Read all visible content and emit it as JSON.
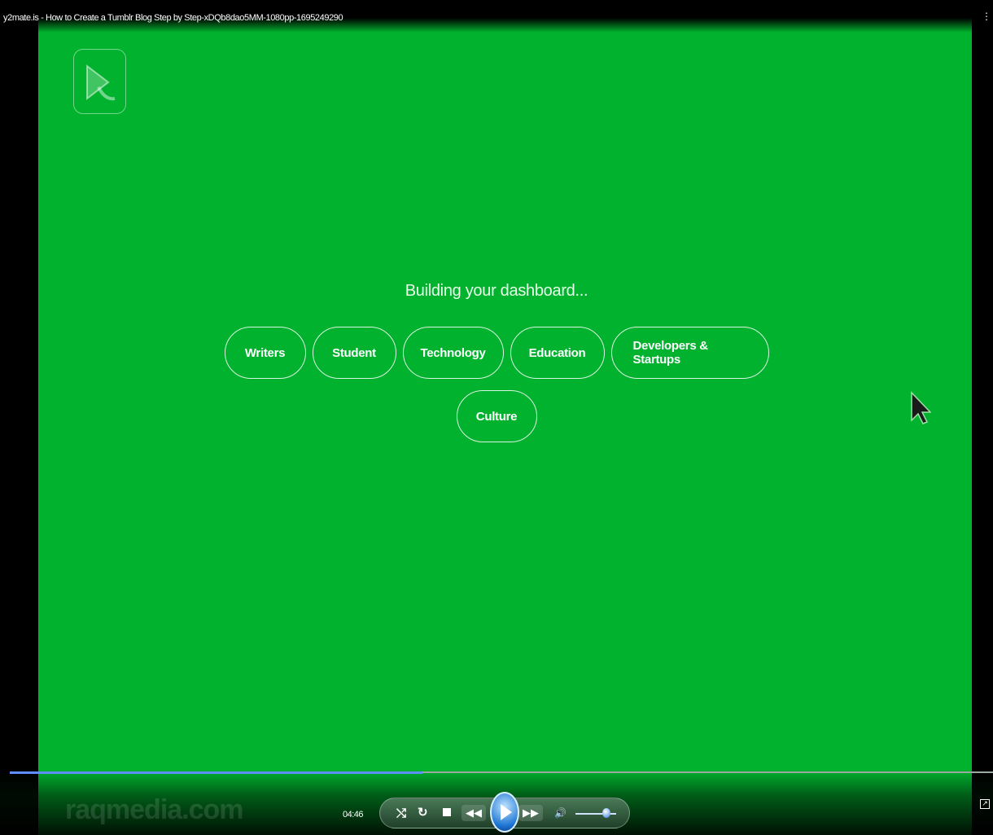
{
  "window": {
    "title": "y2mate.is - How to Create a Tumblr Blog Step by Step-xDQb8dao5MM-1080pp-1695249290"
  },
  "video": {
    "heading": "Building your dashboard...",
    "chips": [
      "Writers",
      "Student",
      "Technology",
      "Education",
      "Developers & Startups",
      "Culture"
    ],
    "background_color": "#00b22e"
  },
  "player": {
    "time": "04:46",
    "watermark": "raqmedia.com",
    "progress": 0.42,
    "volume": 0.75,
    "icons": {
      "shuffle": "shuffle-icon",
      "repeat": "repeat-icon",
      "stop": "stop-icon",
      "prev": "rewind-icon",
      "play": "play-icon",
      "next": "fast-forward-icon",
      "volume": "volume-icon",
      "fullscreen": "fullscreen-icon"
    },
    "accent": "#1c74d3"
  }
}
